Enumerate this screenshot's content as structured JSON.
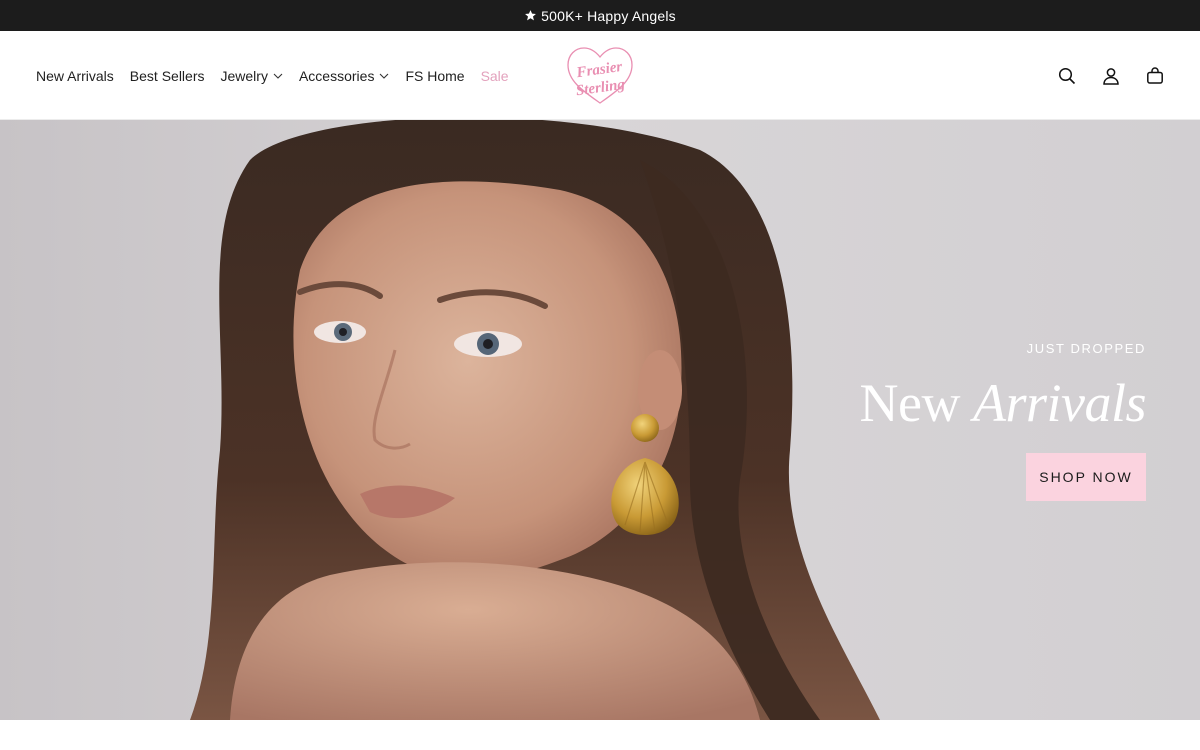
{
  "announcement": {
    "text": "500K+ Happy Angels",
    "icon": "star-icon"
  },
  "nav": {
    "items": [
      {
        "label": "New Arrivals",
        "has_dropdown": false
      },
      {
        "label": "Best Sellers",
        "has_dropdown": false
      },
      {
        "label": "Jewelry",
        "has_dropdown": true
      },
      {
        "label": "Accessories",
        "has_dropdown": true
      },
      {
        "label": "FS Home",
        "has_dropdown": false
      },
      {
        "label": "Sale",
        "has_dropdown": false
      }
    ]
  },
  "logo": {
    "line1": "Frasier",
    "line2": "Sterling",
    "icon": "heart-logo-icon"
  },
  "header_icons": [
    "search-icon",
    "account-icon",
    "cart-icon"
  ],
  "hero": {
    "eyebrow": "JUST DROPPED",
    "headline_plain": "New",
    "headline_italic": "Arrivals",
    "cta_label": "SHOP NOW"
  },
  "colors": {
    "announcement_bg": "#1c1c1c",
    "sale_text": "#e3a2bd",
    "cta_bg": "#fbd3df",
    "logo_pink": "#e98fb2"
  }
}
